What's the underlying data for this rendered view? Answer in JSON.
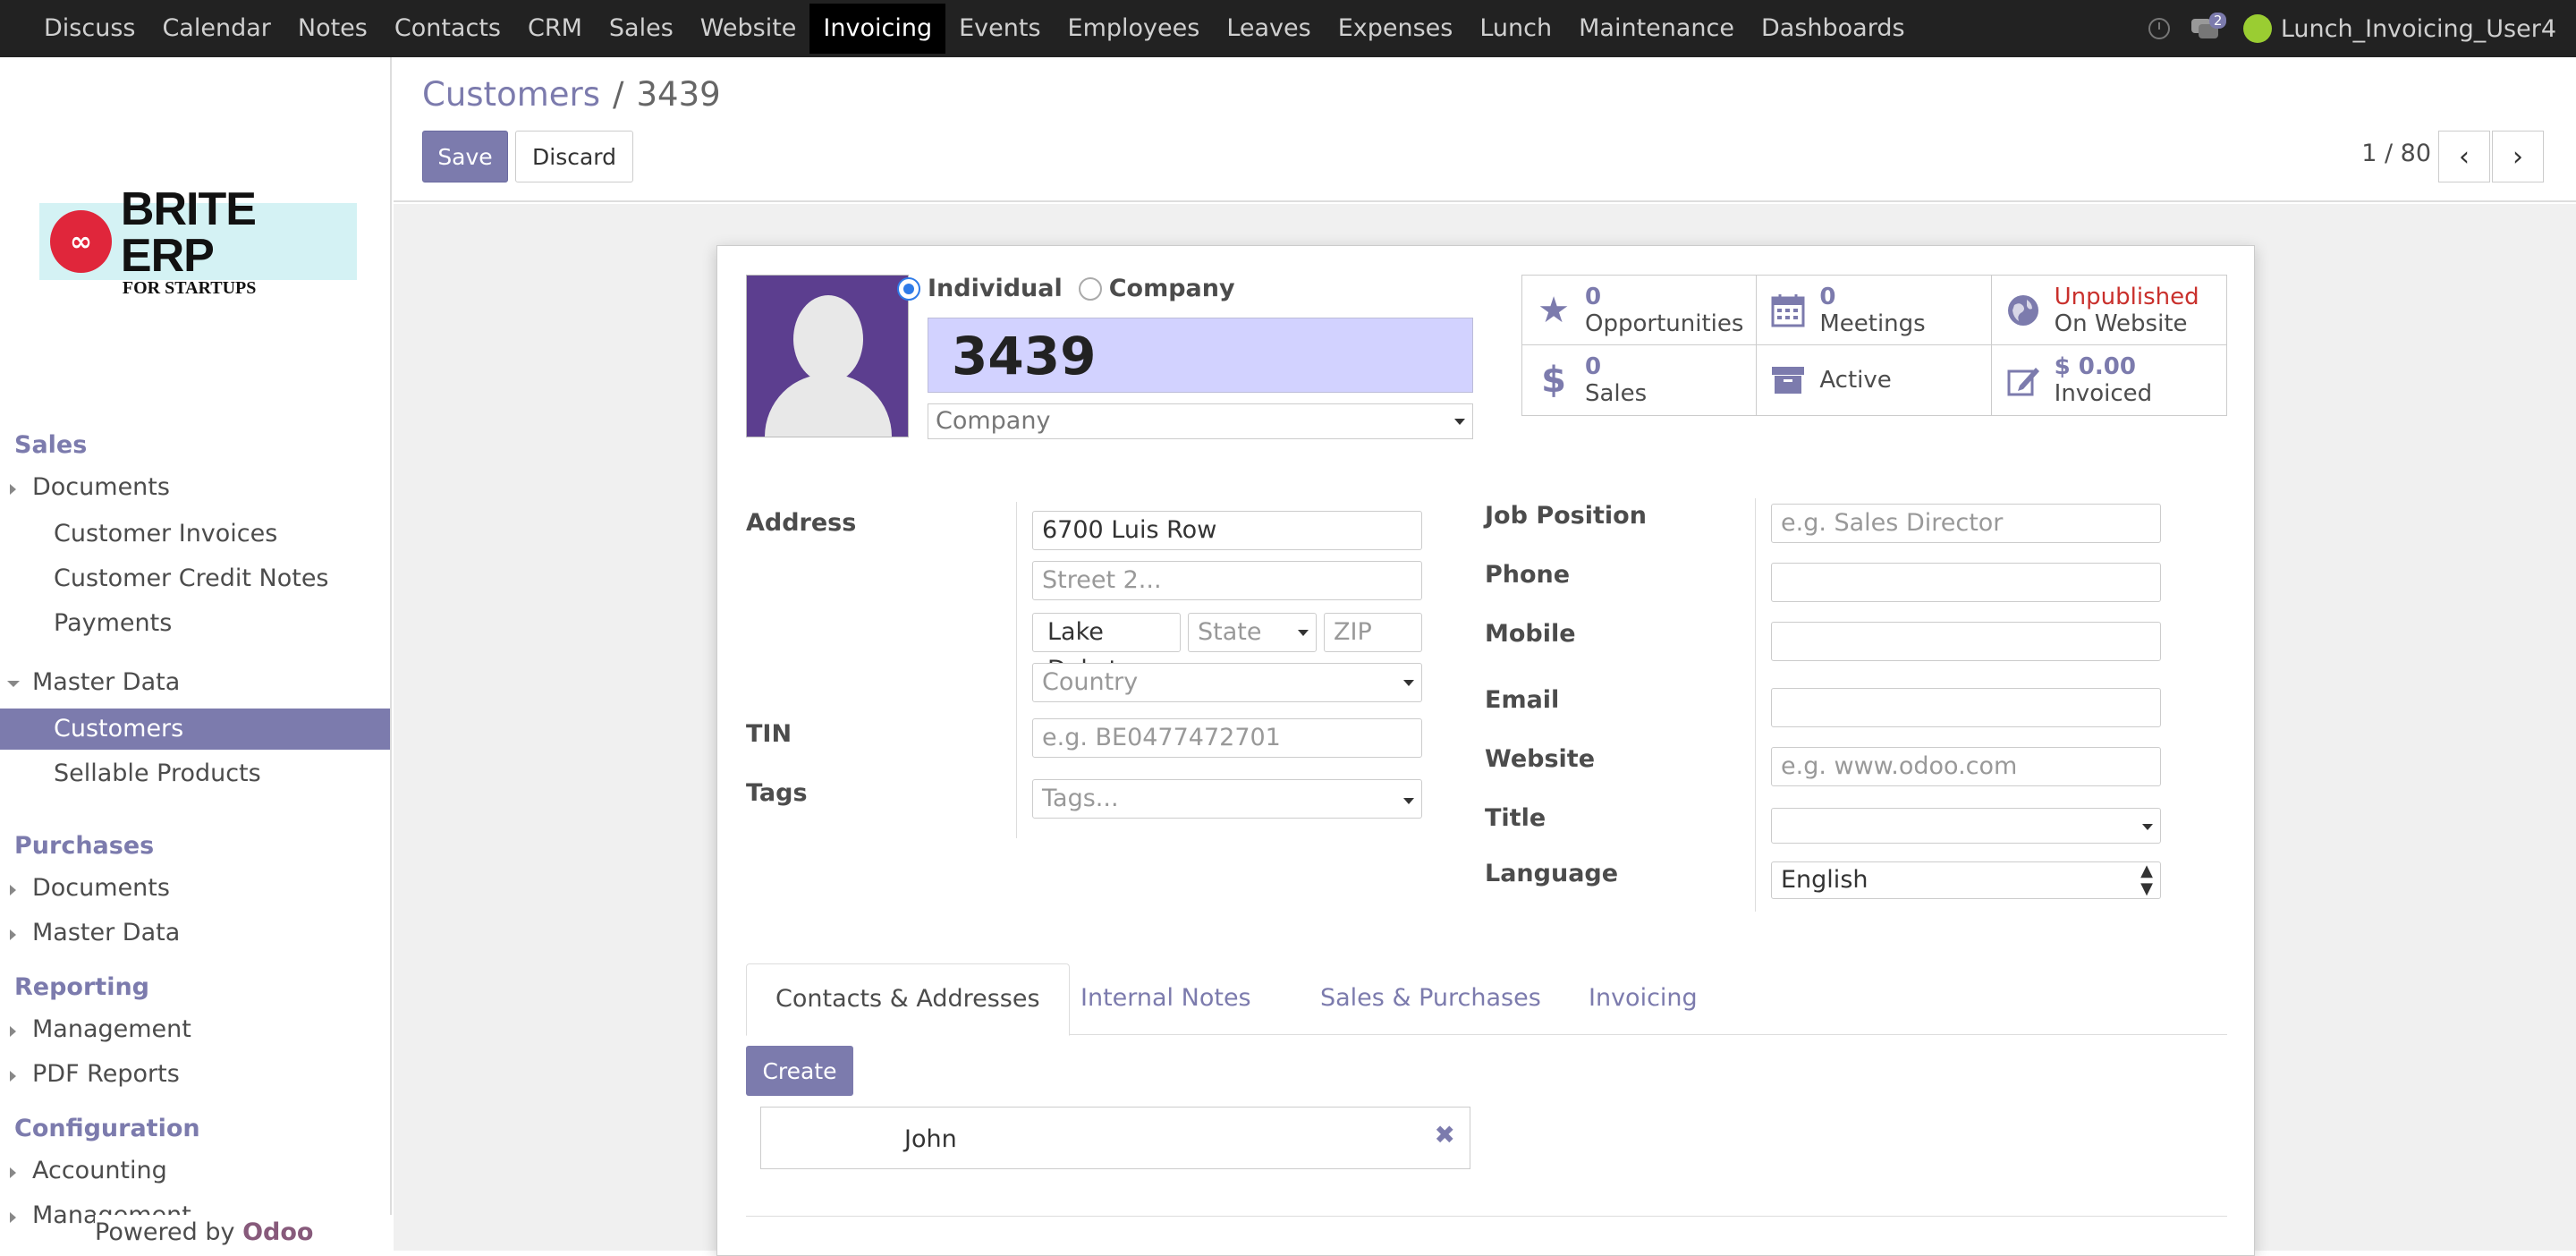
{
  "topbar": {
    "menu": [
      "Discuss",
      "Calendar",
      "Notes",
      "Contacts",
      "CRM",
      "Sales",
      "Website",
      "Invoicing",
      "Events",
      "Employees",
      "Leaves",
      "Expenses",
      "Lunch",
      "Maintenance",
      "Dashboards"
    ],
    "active": "Invoicing",
    "message_count": "2",
    "user": "Lunch_Invoicing_User4"
  },
  "logo": {
    "main": "BRITE ERP",
    "sub": "FOR STARTUPS"
  },
  "sidebar": {
    "sales_head": "Sales",
    "documents": "Documents",
    "customer_invoices": "Customer Invoices",
    "customer_credit_notes": "Customer Credit Notes",
    "payments": "Payments",
    "master_data": "Master Data",
    "customers": "Customers",
    "sellable_products": "Sellable Products",
    "purchases_head": "Purchases",
    "p_documents": "Documents",
    "p_master_data": "Master Data",
    "reporting_head": "Reporting",
    "management": "Management",
    "pdf_reports": "PDF Reports",
    "configuration_head": "Configuration",
    "accounting": "Accounting",
    "c_management": "Management",
    "powered_prefix": "Powered by",
    "powered_brand": "Odoo"
  },
  "cp": {
    "breadcrumb_link": "Customers",
    "breadcrumb_sep": "/",
    "breadcrumb_current": "3439",
    "save": "Save",
    "discard": "Discard",
    "pager": "1 / 80"
  },
  "form": {
    "type_individual": "Individual",
    "type_company": "Company",
    "name": "3439",
    "company_placeholder": "Company",
    "smart_buttons": {
      "opportunities_num": "0",
      "opportunities_label": "Opportunities",
      "meetings_num": "0",
      "meetings_label": "Meetings",
      "website_status": "Unpublished",
      "website_label": "On Website",
      "sales_num": "0",
      "sales_label": "Sales",
      "active_label": "Active",
      "invoiced_num": "$ 0.00",
      "invoiced_label": "Invoiced"
    },
    "address_label": "Address",
    "street": "6700 Luis Row",
    "street2_placeholder": "Street 2...",
    "city": "Lake Dakot",
    "state_placeholder": "State",
    "zip_placeholder": "ZIP",
    "country_placeholder": "Country",
    "tin_label": "TIN",
    "tin_placeholder": "e.g. BE0477472701",
    "tags_label": "Tags",
    "tags_placeholder": "Tags...",
    "job_position_label": "Job Position",
    "job_position_placeholder": "e.g. Sales Director",
    "phone_label": "Phone",
    "mobile_label": "Mobile",
    "email_label": "Email",
    "website_label": "Website",
    "website_placeholder": "e.g. www.odoo.com",
    "title_label": "Title",
    "language_label": "Language",
    "language_value": "English"
  },
  "tabs": [
    "Contacts & Addresses",
    "Internal Notes",
    "Sales & Purchases",
    "Invoicing"
  ],
  "contacts": {
    "create": "Create",
    "items": [
      "John"
    ]
  }
}
